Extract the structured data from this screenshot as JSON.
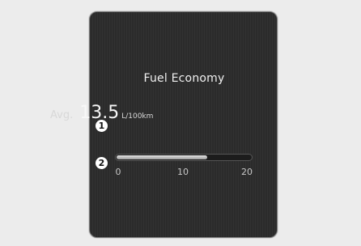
{
  "display": {
    "title": "Fuel Economy",
    "avg_label": "Avg.",
    "avg_value": "13.5",
    "avg_unit": "L/100km"
  },
  "gauge": {
    "min": 0,
    "max": 20,
    "value": 13.5,
    "ticks": [
      "0",
      "10",
      "20"
    ]
  },
  "callouts": [
    "1",
    "2"
  ]
}
